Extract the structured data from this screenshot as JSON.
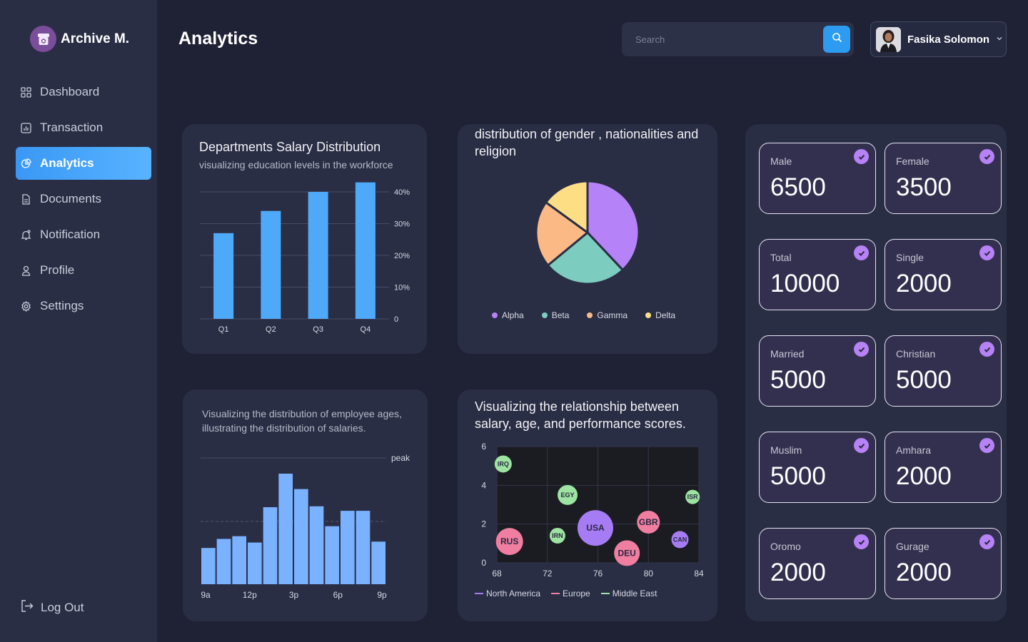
{
  "app": {
    "name": "Archive M."
  },
  "sidebar": {
    "items": [
      {
        "label": "Dashboard",
        "icon": "grid-icon"
      },
      {
        "label": "Transaction",
        "icon": "chart-icon"
      },
      {
        "label": "Analytics",
        "icon": "pie-icon",
        "active": true
      },
      {
        "label": "Documents",
        "icon": "document-icon"
      },
      {
        "label": "Notification",
        "icon": "bell-icon"
      },
      {
        "label": "Profile",
        "icon": "user-icon"
      },
      {
        "label": "Settings",
        "icon": "gear-icon"
      }
    ],
    "logout_label": "Log Out"
  },
  "header": {
    "title": "Analytics",
    "search_placeholder": "Search",
    "user_name": "Fasika Solomon"
  },
  "colors": {
    "accent": "#3a98f5",
    "bar": "#4fa9f9",
    "histogram": "#7ab2ff",
    "stat_check": "#b682f5"
  },
  "cards": {
    "salary": {
      "title": "Departments Salary Distribution",
      "subtitle": "visualizing education levels in the workforce"
    },
    "distribution": {
      "title": "distribution of gender , nationalities and religion"
    },
    "ages": {
      "subtitle": "Visualizing the distribution of employee ages, illustrating the distribution of salaries."
    },
    "bubble": {
      "title": "Visualizing the relationship between salary, age, and performance scores."
    }
  },
  "chart_data": [
    {
      "type": "bar",
      "categories": [
        "Q1",
        "Q2",
        "Q3",
        "Q4"
      ],
      "values": [
        27,
        34,
        40,
        43
      ],
      "ylim": [
        0,
        40
      ],
      "yticks": [
        "0",
        "10%",
        "20%",
        "30%",
        "40%"
      ],
      "grid": true
    },
    {
      "type": "pie",
      "labels": [
        "Alpha",
        "Beta",
        "Gamma",
        "Delta"
      ],
      "values": [
        38,
        26,
        21,
        15
      ],
      "colors": [
        "#b583f7",
        "#7ccdc0",
        "#fbb985",
        "#fdde84"
      ],
      "legend": "bottom"
    },
    {
      "type": "bar",
      "subtype": "histogram",
      "values": [
        4,
        5,
        5.3,
        4.6,
        8.5,
        12.2,
        10.5,
        8.6,
        6.4,
        8.1,
        8.1,
        4.7
      ],
      "xticks": [
        "9a",
        "12p",
        "3p",
        "6p",
        "9p"
      ],
      "reference_label": "peak",
      "grid": true
    },
    {
      "type": "scatter",
      "subtype": "bubble",
      "xlim": [
        68,
        84
      ],
      "ylim": [
        0,
        6
      ],
      "xticks": [
        68,
        72,
        76,
        80,
        84
      ],
      "yticks": [
        0,
        2,
        4,
        6
      ],
      "series": [
        {
          "name": "North America",
          "color": "#a67cf5",
          "points": [
            {
              "label": "USA",
              "x": 75.8,
              "y": 1.8,
              "size": 25
            },
            {
              "label": "CAN",
              "x": 82.5,
              "y": 1.2,
              "size": 12
            }
          ]
        },
        {
          "name": "Europe",
          "color": "#f07ea0",
          "points": [
            {
              "label": "RUS",
              "x": 69,
              "y": 1.1,
              "size": 19
            },
            {
              "label": "GBR",
              "x": 80,
              "y": 2.1,
              "size": 16
            },
            {
              "label": "DEU",
              "x": 78.3,
              "y": 0.5,
              "size": 18
            }
          ]
        },
        {
          "name": "Middle East",
          "color": "#9de3a1",
          "points": [
            {
              "label": "IRQ",
              "x": 68.5,
              "y": 5.1,
              "size": 12
            },
            {
              "label": "EGY",
              "x": 73.6,
              "y": 3.5,
              "size": 14
            },
            {
              "label": "IRN",
              "x": 72.8,
              "y": 1.4,
              "size": 11
            },
            {
              "label": "ISR",
              "x": 83.5,
              "y": 3.4,
              "size": 10
            }
          ]
        }
      ],
      "legend": "bottom"
    }
  ],
  "stats": [
    {
      "label": "Male",
      "value": "6500"
    },
    {
      "label": "Female",
      "value": "3500"
    },
    {
      "label": "Total",
      "value": "10000"
    },
    {
      "label": "Single",
      "value": "2000"
    },
    {
      "label": "Married",
      "value": "5000"
    },
    {
      "label": "Christian",
      "value": "5000"
    },
    {
      "label": "Muslim",
      "value": "5000"
    },
    {
      "label": "Amhara",
      "value": "2000"
    },
    {
      "label": "Oromo",
      "value": "2000"
    },
    {
      "label": "Gurage",
      "value": "2000"
    }
  ]
}
